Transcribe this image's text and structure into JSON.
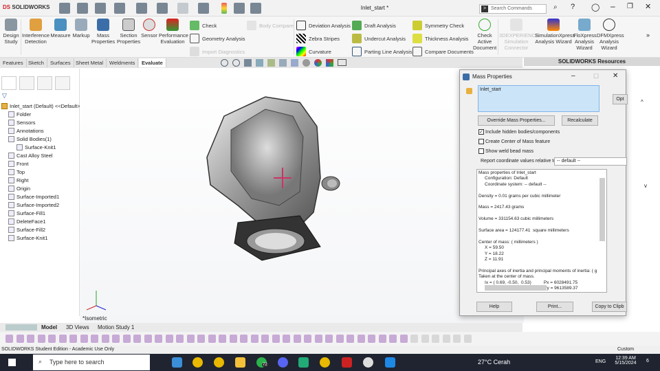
{
  "app": {
    "logo_ds": "DS",
    "logo": "SOLIDWORKS",
    "title": "Inlet_start *",
    "search_placeholder": "Search Commands"
  },
  "ribbon": {
    "big": [
      {
        "label": "Design Study"
      },
      {
        "label": "Interference Detection"
      },
      {
        "label": "Measure"
      },
      {
        "label": "Markup"
      },
      {
        "label": "Mass Properties"
      },
      {
        "label": "Section Properties"
      },
      {
        "label": "Sensor"
      },
      {
        "label": "Performance Evaluation"
      }
    ],
    "col1": [
      "Check",
      "Geometry Analysis",
      "Import Diagnostics"
    ],
    "body_compare": "Body Compare",
    "col2": [
      "Deviation Analysis",
      "Zebra Stripes",
      "Curvature"
    ],
    "col3": [
      "Draft Analysis",
      "Undercut Analysis",
      "Parting Line Analysis"
    ],
    "col4": [
      "Symmetry Check",
      "Thickness Analysis",
      "Compare Documents"
    ],
    "check_active": "Check Active Document",
    "addins": [
      {
        "label": "3DEXPERIENCE Simulation Connector",
        "disabled": true
      },
      {
        "label": "SimulationXpress Analysis Wizard"
      },
      {
        "label": "FloXpress Analysis Wizard"
      },
      {
        "label": "DFMXpress Analysis Wizard"
      }
    ]
  },
  "tabs": [
    "Features",
    "Sketch",
    "Surfaces",
    "Sheet Metal",
    "Weldments",
    "Evaluate"
  ],
  "active_tab": "Evaluate",
  "resources_title": "SOLIDWORKS Resources",
  "tree": {
    "root": "Inlet_start (Default) <<Default>",
    "items": [
      "Folder",
      "Sensors",
      "Annotations",
      "Solid Bodies(1)",
      "Surface-Knit1",
      "Cast Alloy Steel",
      "Front",
      "Top",
      "Right",
      "Origin",
      "Surface-Imported1",
      "Surface-Imported2",
      "Surface-Fill1",
      "DeleteFace1",
      "Surface-Fill2",
      "Surface-Knit1"
    ]
  },
  "viewport": {
    "view_label": "*Isometric"
  },
  "dialog": {
    "title": "Mass Properties",
    "selection": "Inlet_start",
    "options_btn": "Opt",
    "override_btn": "Override Mass Properties...",
    "recalc_btn": "Recalculate",
    "checks": [
      {
        "label": "Include hidden bodies/components",
        "checked": true
      },
      {
        "label": "Create Center of Mass feature",
        "checked": false
      },
      {
        "label": "Show weld bead mass",
        "checked": false
      }
    ],
    "coord_label": "Report coordinate values relative to:",
    "coord_value": "-- default --",
    "results": [
      "Mass properties of Inlet_start",
      "     Configuration: Default",
      "     Coordinate system: -- default --",
      "",
      "Density = 0.01 grams per cubic millimeter",
      "",
      "Mass = 2417.43 grams",
      "",
      "Volume = 331154.63 cubic millimeters",
      "",
      "Surface area = 124177.41  square millimeters",
      "",
      "Center of mass: ( millimeters )",
      "     X = 59.50",
      "     Y = 18.22",
      "     Z = 11.91",
      "",
      "Principal axes of inertia and principal moments of inertia: ( g",
      "Taken at the center of mass.",
      "     Ix = ( 0.69, -0.50,  0.53)          Px = 6028491.75",
      "     Iy = ( 0.47, -0.24, -0.85)          Py = 9613589.37"
    ],
    "help_btn": "Help",
    "print_btn": "Print...",
    "copy_btn": "Copy to Clipb"
  },
  "bottom_tabs": [
    "Model",
    "3D Views",
    "Motion Study 1"
  ],
  "status": {
    "left": "SOLIDWORKS Student Edition - Academic Use Only",
    "units": "Custom"
  },
  "taskbar": {
    "search": "Type here to search",
    "weather": "27°C  Cerah",
    "lang": "ENG",
    "time": "12:39 AM",
    "date": "5/15/2024",
    "badge_whatsapp": "72",
    "notif": "6"
  }
}
